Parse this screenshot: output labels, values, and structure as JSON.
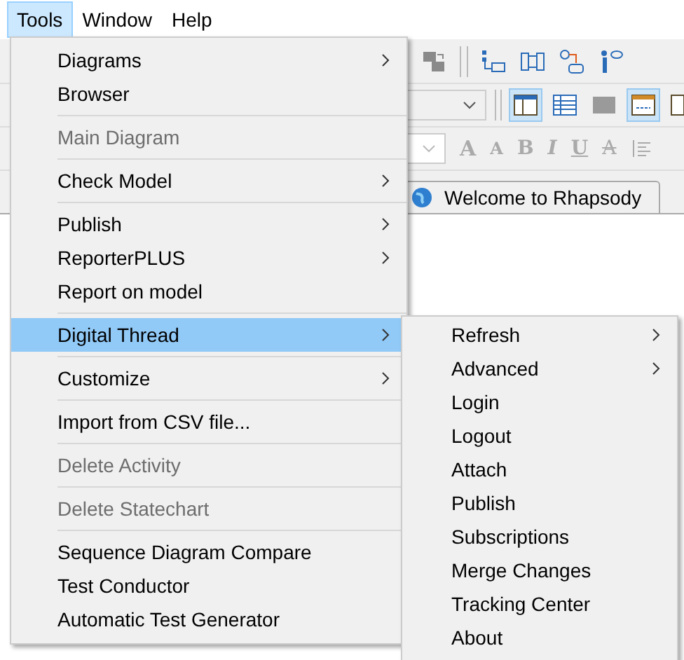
{
  "menubar": [
    {
      "label": "Tools",
      "selected": true
    },
    {
      "label": "Window",
      "selected": false
    },
    {
      "label": "Help",
      "selected": false
    }
  ],
  "format_buttons": [
    "A",
    "A",
    "B",
    "I",
    "U",
    "A"
  ],
  "tab": {
    "label": "Welcome to Rhapsody"
  },
  "menu": [
    {
      "kind": "item",
      "label": "Diagrams",
      "submenu": true,
      "disabled": false,
      "selected": false
    },
    {
      "kind": "item",
      "label": "Browser",
      "submenu": false,
      "disabled": false,
      "selected": false
    },
    {
      "kind": "separator"
    },
    {
      "kind": "item",
      "label": "Main Diagram",
      "submenu": false,
      "disabled": true,
      "selected": false
    },
    {
      "kind": "separator"
    },
    {
      "kind": "item",
      "label": "Check Model",
      "submenu": true,
      "disabled": false,
      "selected": false
    },
    {
      "kind": "separator"
    },
    {
      "kind": "item",
      "label": "Publish",
      "submenu": true,
      "disabled": false,
      "selected": false
    },
    {
      "kind": "item",
      "label": "ReporterPLUS",
      "submenu": true,
      "disabled": false,
      "selected": false
    },
    {
      "kind": "item",
      "label": "Report on model",
      "submenu": false,
      "disabled": false,
      "selected": false
    },
    {
      "kind": "separator"
    },
    {
      "kind": "item",
      "label": "Digital Thread",
      "submenu": true,
      "disabled": false,
      "selected": true
    },
    {
      "kind": "separator"
    },
    {
      "kind": "item",
      "label": "Customize",
      "submenu": true,
      "disabled": false,
      "selected": false
    },
    {
      "kind": "separator"
    },
    {
      "kind": "item",
      "label": "Import from CSV file...",
      "submenu": false,
      "disabled": false,
      "selected": false
    },
    {
      "kind": "separator"
    },
    {
      "kind": "item",
      "label": "Delete Activity",
      "submenu": false,
      "disabled": true,
      "selected": false
    },
    {
      "kind": "separator"
    },
    {
      "kind": "item",
      "label": "Delete Statechart",
      "submenu": false,
      "disabled": true,
      "selected": false
    },
    {
      "kind": "separator"
    },
    {
      "kind": "item",
      "label": "Sequence Diagram Compare",
      "submenu": false,
      "disabled": false,
      "selected": false
    },
    {
      "kind": "item",
      "label": "Test Conductor",
      "submenu": false,
      "disabled": false,
      "selected": false
    },
    {
      "kind": "item",
      "label": "Automatic Test Generator",
      "submenu": false,
      "disabled": false,
      "selected": false
    }
  ],
  "submenu": [
    {
      "label": "Refresh",
      "submenu": true
    },
    {
      "label": "Advanced",
      "submenu": true
    },
    {
      "label": "Login",
      "submenu": false
    },
    {
      "label": "Logout",
      "submenu": false
    },
    {
      "label": "Attach",
      "submenu": false
    },
    {
      "label": "Publish",
      "submenu": false
    },
    {
      "label": "Subscriptions",
      "submenu": false
    },
    {
      "label": "Merge Changes",
      "submenu": false
    },
    {
      "label": "Tracking Center",
      "submenu": false
    },
    {
      "label": "About",
      "submenu": false
    }
  ]
}
